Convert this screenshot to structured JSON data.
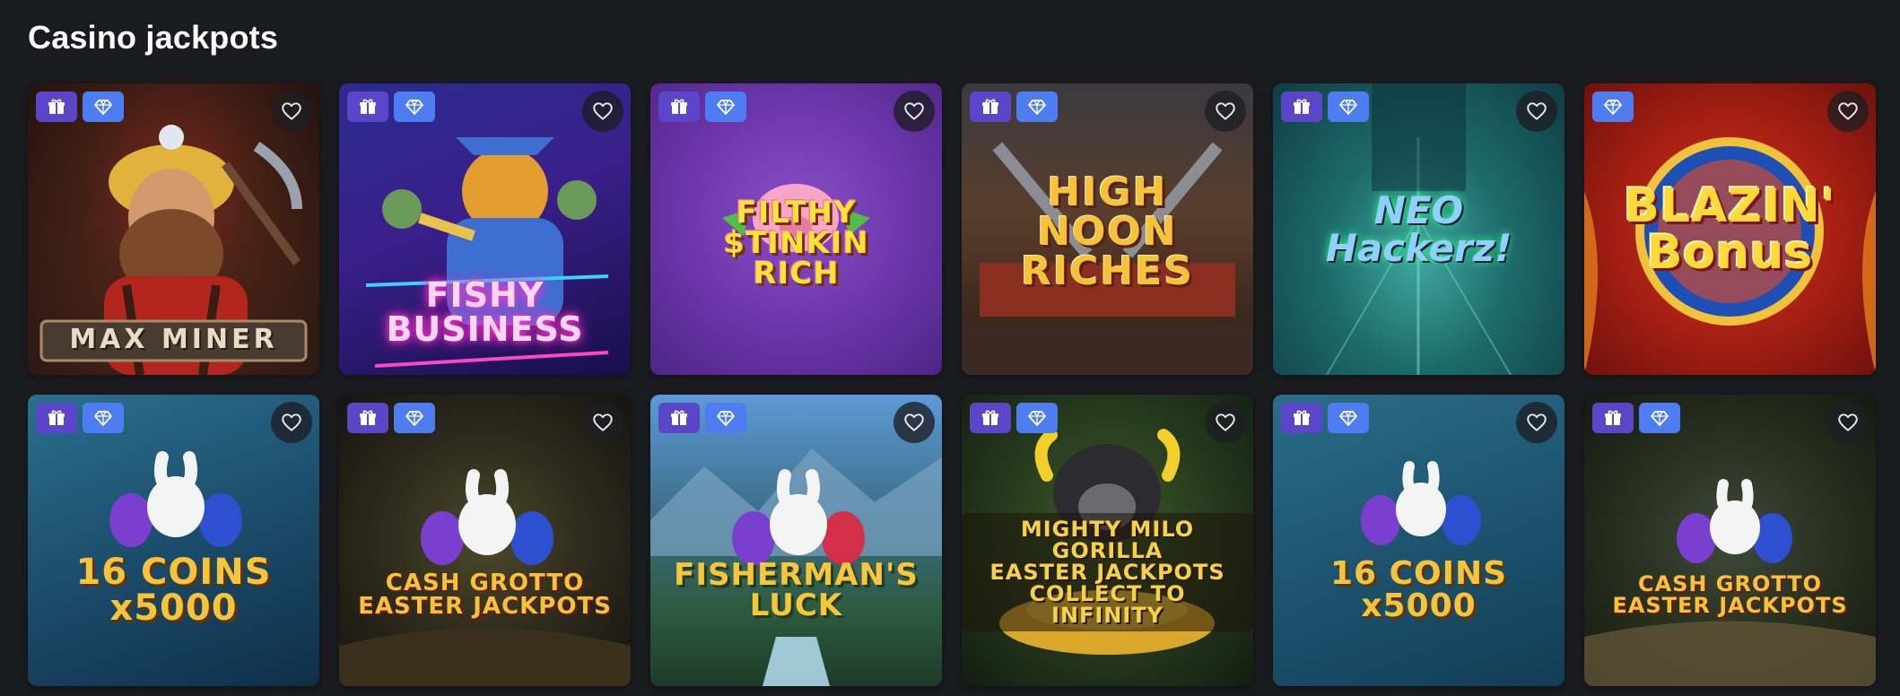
{
  "section": {
    "title": "Casino jackpots"
  },
  "icons": {
    "gift": "gift-icon",
    "gem": "diamond-icon",
    "favorite": "heart-icon"
  },
  "colors": {
    "page_bg": "#1a1b1f",
    "badge_gift": "#5b45c9",
    "badge_gem": "#4d7df0"
  },
  "games": [
    {
      "id": "max-miner",
      "logo_text": "MAX MINER",
      "badges": [
        "gift",
        "gem"
      ]
    },
    {
      "id": "fishy-business",
      "logo_text": "FISHY\nBUSINESS",
      "badges": [
        "gift",
        "gem"
      ]
    },
    {
      "id": "filthy-stinkin-rich",
      "logo_text": "FILTHY\n$TINKIN\nRICH",
      "badges": [
        "gift",
        "gem"
      ]
    },
    {
      "id": "high-noon-riches",
      "logo_text": "HIGH\nNOON\nRICHES",
      "badges": [
        "gift",
        "gem"
      ]
    },
    {
      "id": "neo-hackerz",
      "logo_text": "NEO\nHackerz!",
      "badges": [
        "gift",
        "gem"
      ]
    },
    {
      "id": "blazin-bonus",
      "logo_text": "BLAZIN'\nBonus",
      "badges": [
        "gem"
      ]
    },
    {
      "id": "16-coins-1",
      "logo_text": "16 COINS\nx5000",
      "badges": [
        "gift",
        "gem"
      ]
    },
    {
      "id": "cash-grotto-1",
      "logo_text": "CASH GROTTO\nEASTER JACKPOTS",
      "badges": [
        "gift",
        "gem"
      ]
    },
    {
      "id": "fishermans-luck",
      "logo_text": "FISHERMAN'S\nLUCK",
      "badges": [
        "gift",
        "gem"
      ]
    },
    {
      "id": "mighty-milo-gorilla",
      "logo_text": "MIGHTY MILO\nGORILLA\nEASTER JACKPOTS COLLECT TO INFINITY",
      "badges": [
        "gift",
        "gem"
      ]
    },
    {
      "id": "16-coins-2",
      "logo_text": "16 COINS\nx5000",
      "badges": [
        "gift",
        "gem"
      ]
    },
    {
      "id": "cash-grotto-2",
      "logo_text": "CASH GROTTO\nEASTER JACKPOTS",
      "badges": [
        "gift",
        "gem"
      ]
    }
  ]
}
